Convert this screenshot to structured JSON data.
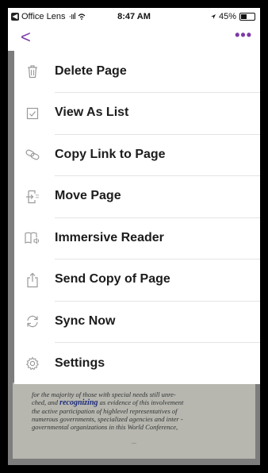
{
  "status_bar": {
    "app_name": "Office Lens",
    "signal": "·ııl",
    "time": "8:47 AM",
    "battery": "45%",
    "battery_level": 0.45
  },
  "nav": {
    "back": "<",
    "more": "•••"
  },
  "menu": {
    "items": [
      {
        "label": "Delete Page",
        "icon": "trash-icon"
      },
      {
        "label": "View As List",
        "icon": "checkbox-icon"
      },
      {
        "label": "Copy Link to Page",
        "icon": "link-icon"
      },
      {
        "label": "Move Page",
        "icon": "move-page-icon"
      },
      {
        "label": "Immersive Reader",
        "icon": "immersive-reader-icon"
      },
      {
        "label": "Send Copy of Page",
        "icon": "share-icon"
      },
      {
        "label": "Sync Now",
        "icon": "sync-icon"
      },
      {
        "label": "Settings",
        "icon": "gear-icon"
      }
    ]
  },
  "document": {
    "line1": "for the majority of those with special needs still unre-",
    "line2_pre": "ched, and ",
    "line2_hl": "recognizing",
    "line2_post": " as evidence of this involvement",
    "line3": "the active participation of highlevel representatives of",
    "line4": "numerous governments, specialized agencies and inter -",
    "line5": "governmental organizations in this World Conference,",
    "footer": "—"
  },
  "colors": {
    "accent": "#7c3aa7",
    "icon": "#9a9a9a"
  }
}
